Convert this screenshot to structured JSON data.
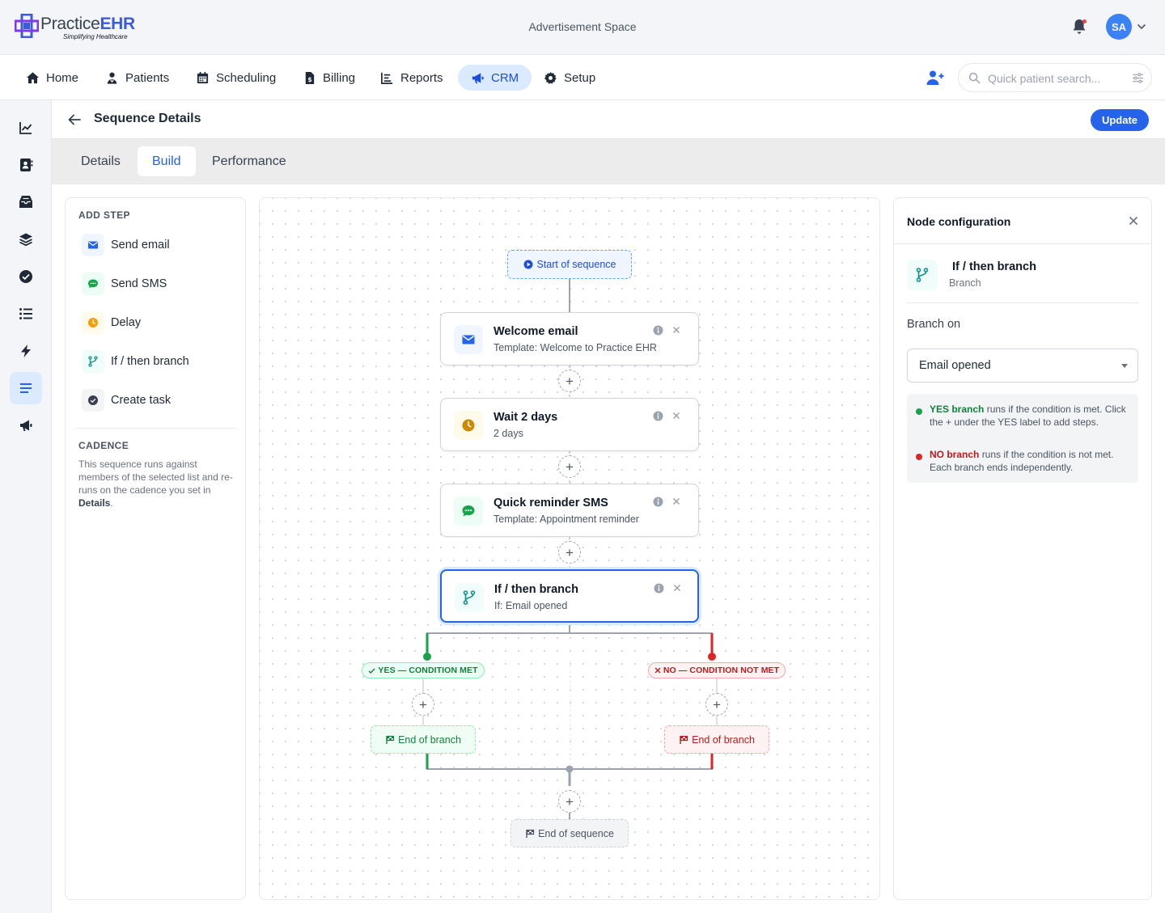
{
  "app": {
    "logo_name_a": "Practice",
    "logo_name_b": "EHR",
    "logo_tagline": "Simplifying Healthcare",
    "ad_space": "Advertisement Space",
    "avatar_initials": "SA"
  },
  "nav": {
    "items": [
      {
        "label": "Home",
        "icon": "home-icon"
      },
      {
        "label": "Patients",
        "icon": "patient-icon"
      },
      {
        "label": "Scheduling",
        "icon": "calendar-icon"
      },
      {
        "label": "Billing",
        "icon": "invoice-icon"
      },
      {
        "label": "Reports",
        "icon": "chart-icon"
      },
      {
        "label": "CRM",
        "icon": "megaphone-icon",
        "active": true
      },
      {
        "label": "Setup",
        "icon": "gear-icon"
      }
    ],
    "search_placeholder": "Quick patient search..."
  },
  "page": {
    "title": "Sequence Details",
    "update_label": "Update",
    "tabs": [
      {
        "label": "Details"
      },
      {
        "label": "Build",
        "active": true
      },
      {
        "label": "Performance"
      }
    ]
  },
  "add_step": {
    "heading": "ADD STEP",
    "items": [
      {
        "label": "Send email",
        "icon": "envelope-icon"
      },
      {
        "label": "Send SMS",
        "icon": "chat-icon"
      },
      {
        "label": "Delay",
        "icon": "clock-icon"
      },
      {
        "label": "If / then branch",
        "icon": "branch-icon"
      },
      {
        "label": "Create task",
        "icon": "check-circle-icon"
      }
    ],
    "cadence_heading": "CADENCE",
    "cadence_text": "This sequence runs against members of the selected list and re-runs on the cadence you set in",
    "cadence_link": "Details",
    "cadence_end": "."
  },
  "canvas": {
    "start_label": "Start of sequence",
    "nodes": [
      {
        "title": "Welcome email",
        "subtitle": "Template: Welcome to Practice EHR",
        "icon": "envelope-icon"
      },
      {
        "title": "Wait 2 days",
        "subtitle": "2 days",
        "icon": "clock-icon"
      },
      {
        "title": "Quick reminder SMS",
        "subtitle": "Template: Appointment reminder",
        "icon": "chat-icon"
      },
      {
        "title": "If / then branch",
        "subtitle": "If: Email opened",
        "icon": "branch-icon",
        "selected": true
      }
    ],
    "yes_label": "YES — CONDITION MET",
    "no_label": "NO — CONDITION NOT MET",
    "end_branch_label": "End of branch",
    "end_sequence_label": "End of sequence",
    "plus_symbol": "+"
  },
  "config": {
    "title": "Node configuration",
    "node_title": "If / then branch",
    "node_type": "Branch",
    "branch_on_label": "Branch on",
    "branch_on_value": "Email opened",
    "yes_word": "YES branch",
    "yes_text": "runs if the condition is met. Click the + under the YES label to add steps.",
    "no_word": "NO branch",
    "no_text": "runs if the condition is not met. Each branch ends independently."
  },
  "colors": {
    "primary": "#2563eb",
    "yes": "#16a34a",
    "no": "#dc2626",
    "alert_dot": "#ef4444"
  }
}
